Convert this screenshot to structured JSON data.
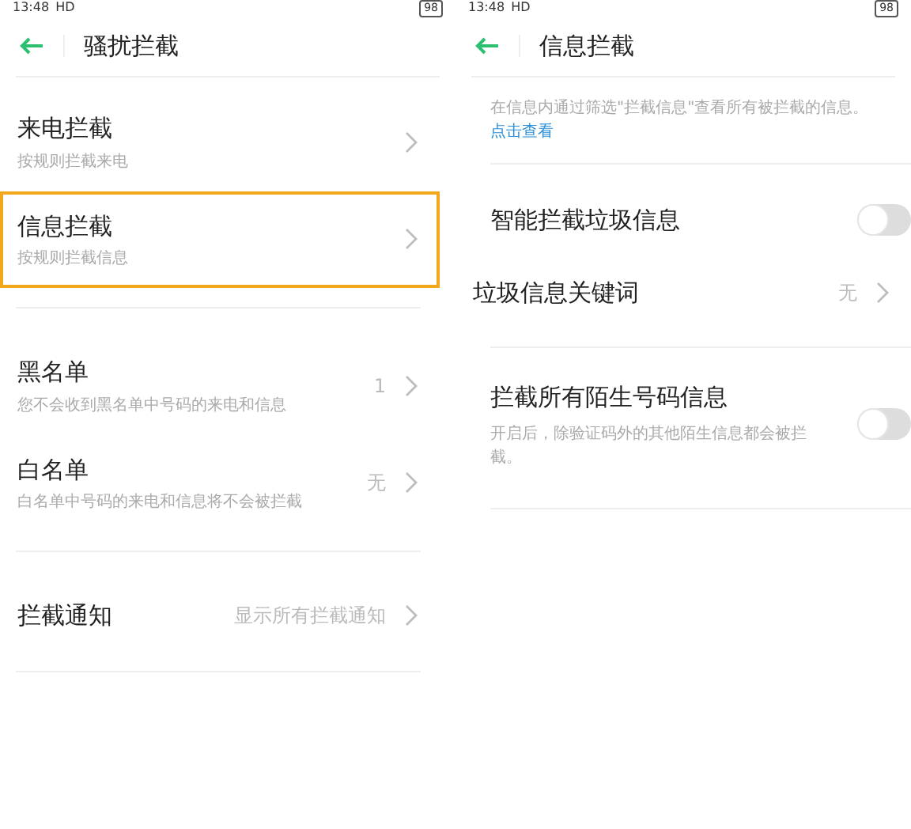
{
  "screens": [
    {
      "status_bar": {
        "time": "13:48",
        "network": "HD",
        "battery": "98"
      },
      "title": "骚扰拦截",
      "sections": [
        [
          {
            "kind": "nav",
            "title": "来电拦截",
            "subtitle": "按规则拦截来电",
            "highlighted": false
          },
          {
            "kind": "nav",
            "title": "信息拦截",
            "subtitle": "按规则拦截信息",
            "highlighted": true
          }
        ],
        [
          {
            "kind": "nav",
            "title": "黑名单",
            "subtitle": "您不会收到黑名单中号码的来电和信息",
            "value": "1",
            "highlighted": false
          },
          {
            "kind": "nav",
            "title": "白名单",
            "subtitle": "白名单中号码的来电和信息将不会被拦截",
            "value": "无",
            "highlighted": false
          }
        ],
        [
          {
            "kind": "nav",
            "title": "拦截通知",
            "value": "显示所有拦截通知",
            "highlighted": false
          }
        ]
      ]
    },
    {
      "status_bar": {
        "time": "13:48",
        "network": "HD",
        "battery": "98"
      },
      "title": "信息拦截",
      "note": {
        "text": "在信息内通过筛选\"拦截信息\"查看所有被拦截的信息。",
        "link": "点击查看"
      },
      "sections": [
        [
          {
            "kind": "toggle",
            "title": "智能拦截垃圾信息",
            "on": false
          },
          {
            "kind": "nav",
            "title": "垃圾信息关键词",
            "value": "无",
            "highlighted": false
          }
        ],
        [
          {
            "kind": "toggle",
            "title": "拦截所有陌生号码信息",
            "subtitle": "开启后，除验证码外的其他陌生信息都会被拦截。",
            "on": false
          }
        ]
      ]
    }
  ]
}
